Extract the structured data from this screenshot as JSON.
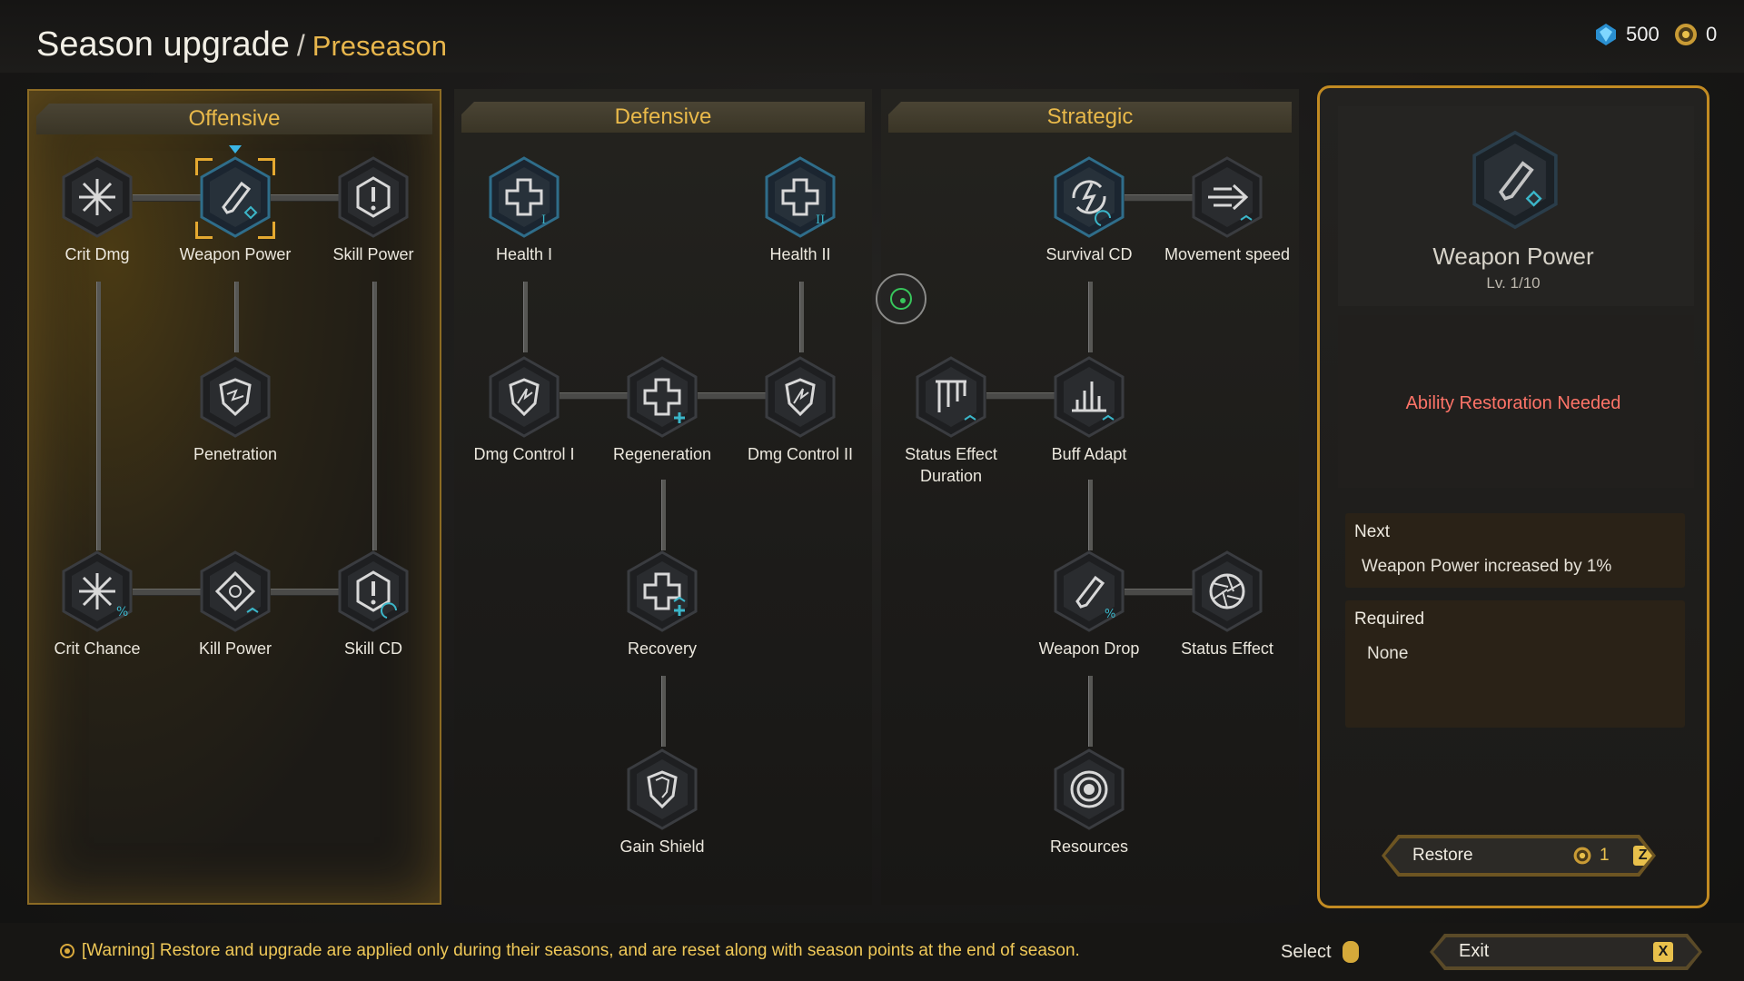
{
  "header": {
    "title": "Season upgrade",
    "separator": "/",
    "subtitle": "Preseason"
  },
  "currency": {
    "crystal": {
      "icon": "blue-crystal-icon",
      "amount": "500"
    },
    "coin": {
      "icon": "gold-gear-coin-icon",
      "amount": "0"
    }
  },
  "panels": {
    "offensive": {
      "title": "Offensive",
      "nodes": {
        "crit_dmg": {
          "label": "Crit Dmg",
          "icon": "starburst-icon"
        },
        "weapon_power": {
          "label": "Weapon Power",
          "icon": "gun-icon",
          "selected": true
        },
        "skill_power": {
          "label": "Skill Power",
          "icon": "exclamation-shield-icon"
        },
        "penetration": {
          "label": "Penetration",
          "icon": "broken-shield-icon"
        },
        "crit_chance": {
          "label": "Crit Chance",
          "icon": "starburst-percent-icon"
        },
        "kill_power": {
          "label": "Kill Power",
          "icon": "target-diamond-icon"
        },
        "skill_cd": {
          "label": "Skill CD",
          "icon": "exclamation-refresh-icon"
        }
      }
    },
    "defensive": {
      "title": "Defensive",
      "nodes": {
        "health_1": {
          "label": "Health I",
          "icon": "medical-cross-icon"
        },
        "health_2": {
          "label": "Health II",
          "icon": "medical-cross-icon"
        },
        "dmg_control_1": {
          "label": "Dmg Control I",
          "icon": "cracked-shield-icon"
        },
        "regeneration": {
          "label": "Regeneration",
          "icon": "cross-plus-icon"
        },
        "dmg_control_2": {
          "label": "Dmg Control II",
          "icon": "cracked-shield-icon"
        },
        "recovery": {
          "label": "Recovery",
          "icon": "cross-plus-icon"
        },
        "gain_shield": {
          "label": "Gain Shield",
          "icon": "shield-icon"
        }
      }
    },
    "strategic": {
      "title": "Strategic",
      "nodes": {
        "survival_cd": {
          "label": "Survival CD",
          "icon": "lightning-swirl-icon"
        },
        "movement_speed": {
          "label": "Movement speed",
          "icon": "speed-arrow-icon"
        },
        "status_effect_duration": {
          "label_line1": "Status Effect",
          "label_line2": "Duration",
          "icon": "bars-icon"
        },
        "buff_adapt": {
          "label": "Buff Adapt",
          "icon": "bar-chart-icon"
        },
        "weapon_drop": {
          "label": "Weapon Drop",
          "icon": "gun-percent-icon"
        },
        "status_effect": {
          "label": "Status Effect",
          "icon": "aperture-icon"
        },
        "resources": {
          "label": "Resources",
          "icon": "concentric-circle-icon"
        }
      }
    }
  },
  "detail": {
    "icon": "gun-icon",
    "name": "Weapon Power",
    "level": "Lv. 1/10",
    "warning": "Ability Restoration Needed",
    "next_label": "Next",
    "next_value": "Weapon Power increased by 1%",
    "required_label": "Required",
    "required_value": "None",
    "restore_label": "Restore",
    "restore_cost": "1",
    "restore_key": "Z"
  },
  "footer": {
    "warning": "[Warning] Restore and upgrade are applied only during their seasons, and are reset along with season points at the end of season.",
    "select_label": "Select",
    "exit_label": "Exit",
    "exit_key": "X"
  },
  "colors": {
    "accent_gold": "#e8b64c",
    "warning_red": "#ff7468",
    "icon_teal": "#3bb6c9",
    "cursor_green": "#38c65c"
  }
}
